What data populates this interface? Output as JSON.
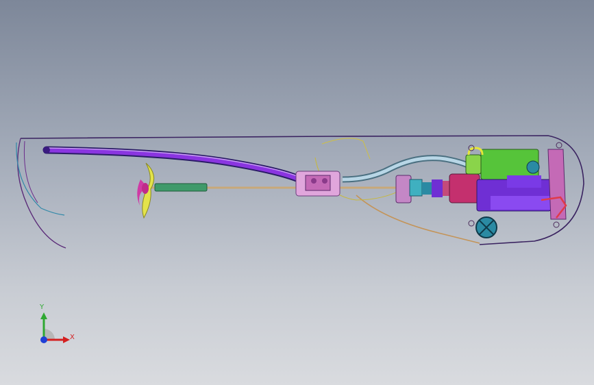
{
  "app": {
    "view_type": "3D CAD model viewport"
  },
  "triad": {
    "y_label": "Y",
    "x_label": "X",
    "colors": {
      "x_axis": "#d42020",
      "y_axis": "#2fa832",
      "z_axis": "#1f3fd6",
      "origin_fan": "#b7b7b7"
    }
  },
  "model": {
    "parts": [
      {
        "name": "hull-outline",
        "color": "#3a2360"
      },
      {
        "name": "exhaust-pipe",
        "color": "#7a2bd1"
      },
      {
        "name": "drive-shaft",
        "color": "#c8a878"
      },
      {
        "name": "propeller",
        "color": "#e3e34a"
      },
      {
        "name": "shaft-sleeve",
        "color": "#3f9a6a"
      },
      {
        "name": "cooling-tube",
        "color": "#9fc3d6"
      },
      {
        "name": "engine-block",
        "color": "#6f2fd4"
      },
      {
        "name": "fuel-tank",
        "color": "#56c43a"
      },
      {
        "name": "flywheel",
        "color": "#2a8aa3"
      },
      {
        "name": "coupler",
        "color": "#c46ab6"
      },
      {
        "name": "servo-mount",
        "color": "#e0a6dc"
      }
    ]
  }
}
